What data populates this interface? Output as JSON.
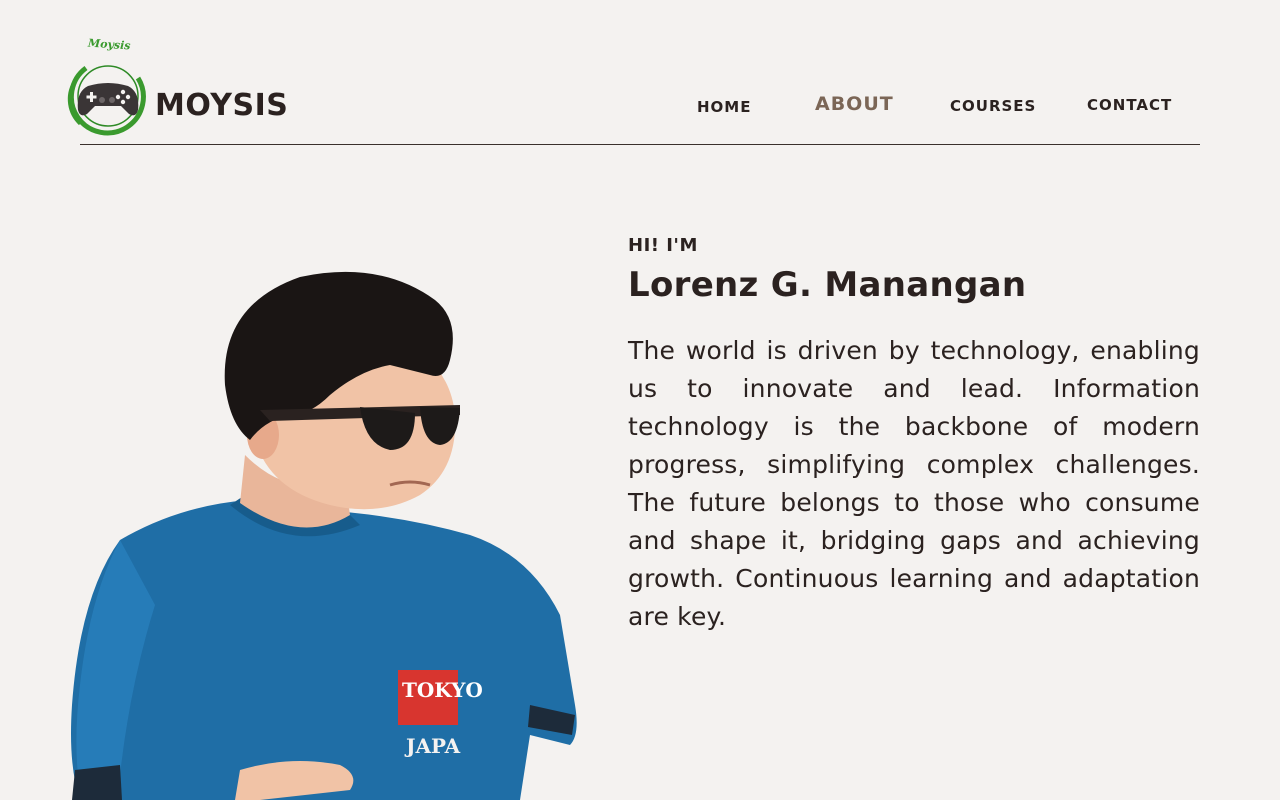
{
  "brand": {
    "script_text": "Moysis",
    "wordmark": "MOYSIS",
    "logo_icon": "gamepad-icon",
    "ring_color": "#3a9a2e"
  },
  "nav": {
    "items": [
      {
        "label": "HOME",
        "active": false
      },
      {
        "label": "ABOUT",
        "active": true
      },
      {
        "label": "COURSES",
        "active": false
      },
      {
        "label": "CONTACT",
        "active": false
      }
    ],
    "active_color": "#7b6656"
  },
  "intro": {
    "greeting": "HI! I'M",
    "name": "Lorenz G. Manangan",
    "bio": "The world is driven by technology, enabling us to innovate and lead. Information technology is the backbone of modern progress, simplifying complex challenges. The future belongs to those who consume and shape it, bridging gaps and achieving growth. Continuous learning and adaptation are key."
  },
  "photo": {
    "shirt_text_1": "TOKYO",
    "shirt_text_2": "JAPA"
  },
  "colors": {
    "background": "#f4f2f0",
    "text": "#2b2220",
    "shirt": "#1f6ea6"
  }
}
